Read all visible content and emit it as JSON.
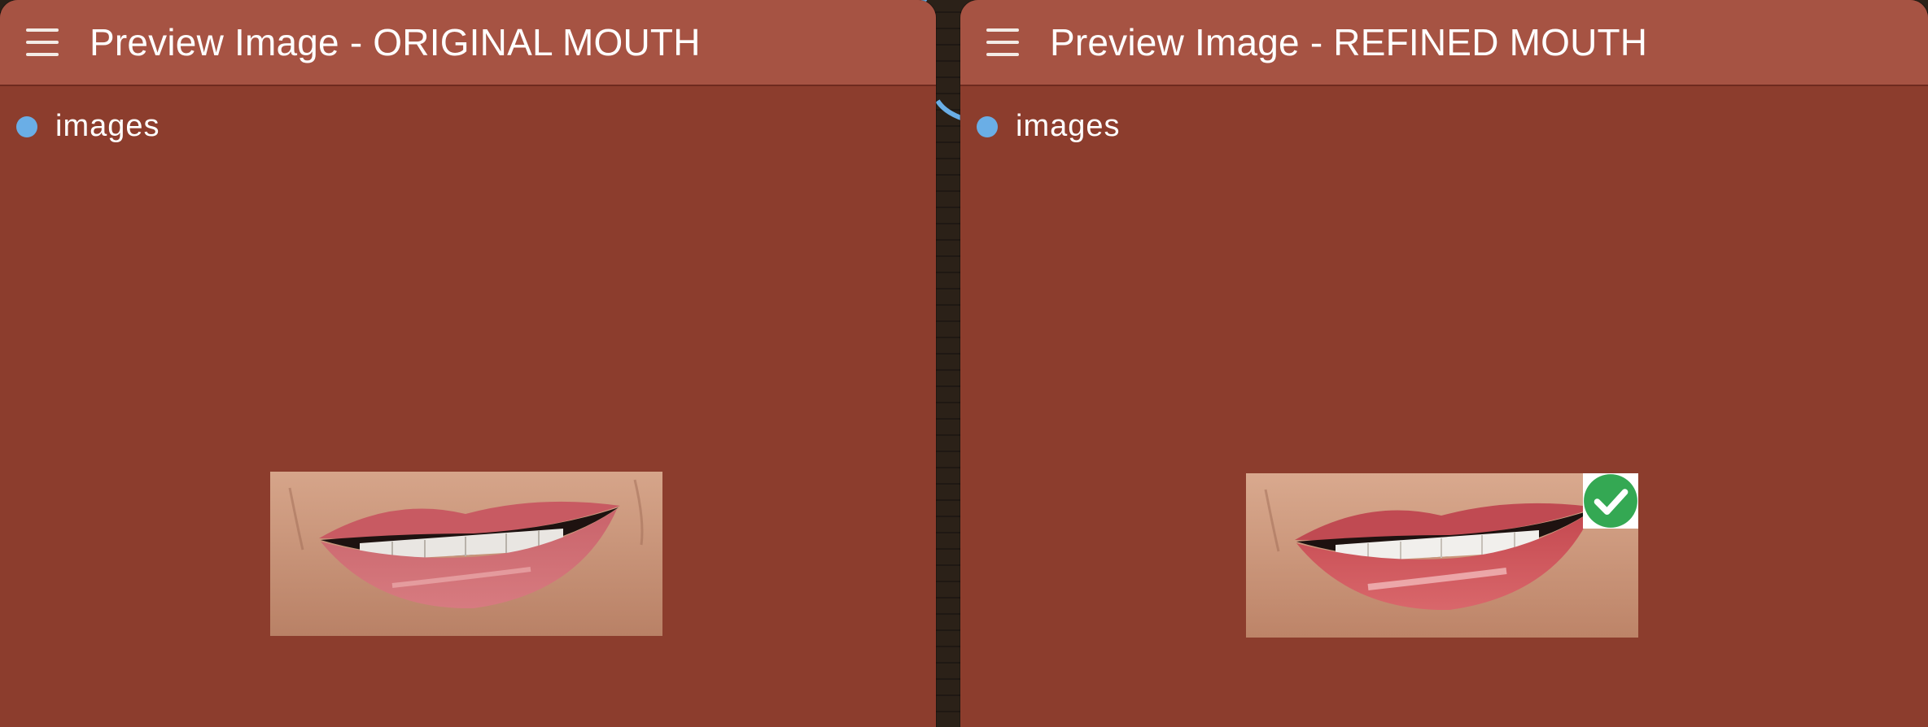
{
  "nodes": {
    "left": {
      "title": "Preview Image - ORIGINAL MOUTH",
      "input_slot": "images",
      "menu_icon": "hamburger-menu-icon"
    },
    "right": {
      "title": "Preview Image - REFINED MOUTH",
      "input_slot": "images",
      "menu_icon": "hamburger-menu-icon",
      "badge_icon": "check-circle-icon"
    }
  },
  "colors": {
    "node_body": "#8c3d2d",
    "node_header": "#a65343",
    "slot_dot": "#6aaee6",
    "link_wire": "#6aaee6",
    "badge_green": "#34a853"
  }
}
